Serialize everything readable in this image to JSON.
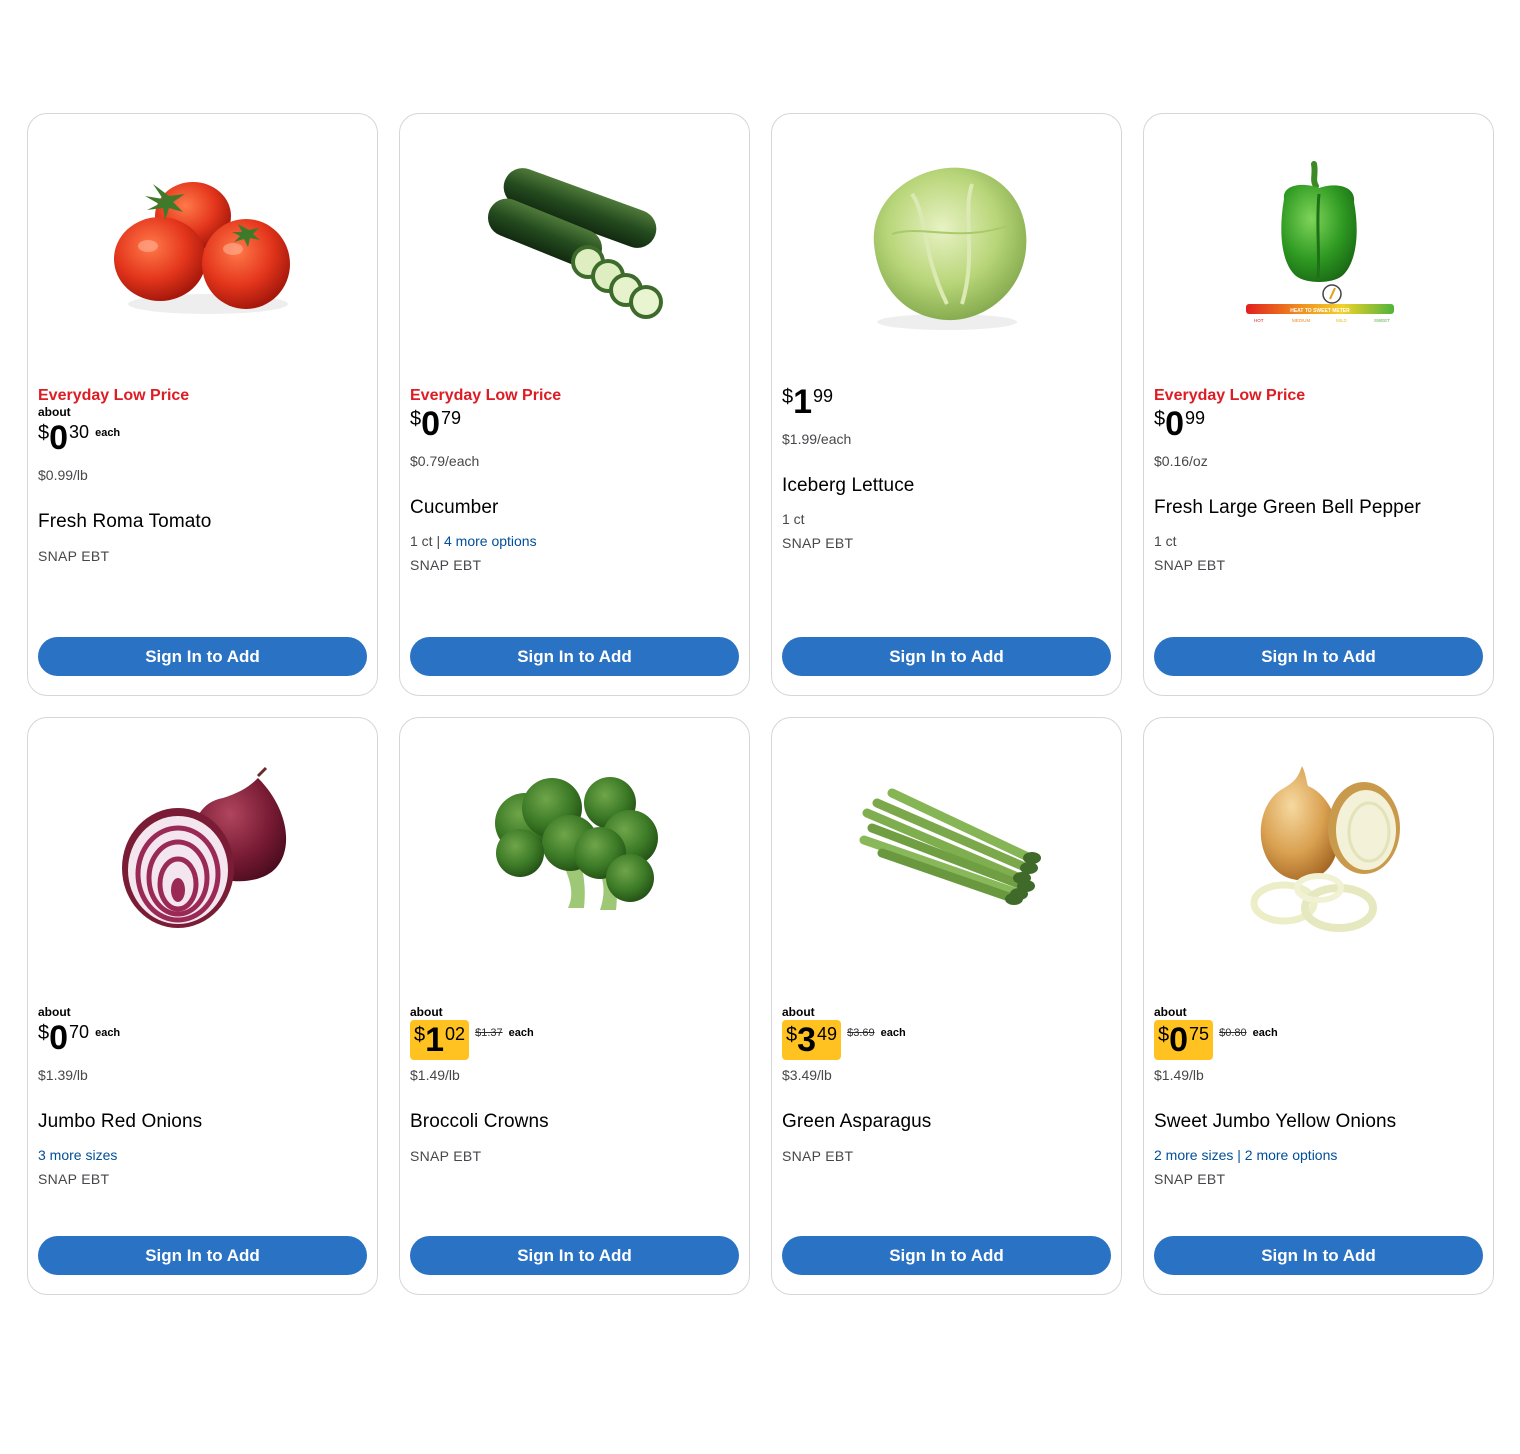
{
  "button_label": "Sign In to Add",
  "products": [
    {
      "flag": "Everyday Low Price",
      "about": "about",
      "price": {
        "currency": "$",
        "dollars": "0",
        "cents": "30",
        "was": "",
        "suffix": "each",
        "rollback": false
      },
      "unit_price": "$0.99/lb",
      "name": "Fresh Roma Tomato",
      "meta_plain": "",
      "meta_link": "",
      "snap": "SNAP EBT",
      "image": "tomato-image"
    },
    {
      "flag": "Everyday Low Price",
      "about": "",
      "price": {
        "currency": "$",
        "dollars": "0",
        "cents": "79",
        "was": "",
        "suffix": "",
        "rollback": false
      },
      "unit_price": "$0.79/each",
      "name": "Cucumber",
      "meta_plain": "1 ct | ",
      "meta_link": "4 more options",
      "snap": "SNAP EBT",
      "image": "cucumber-image"
    },
    {
      "flag": "",
      "about": "",
      "price": {
        "currency": "$",
        "dollars": "1",
        "cents": "99",
        "was": "",
        "suffix": "",
        "rollback": false
      },
      "unit_price": "$1.99/each",
      "name": "Iceberg Lettuce",
      "meta_plain": "1 ct",
      "meta_link": "",
      "snap": "SNAP EBT",
      "image": "lettuce-image"
    },
    {
      "flag": "Everyday Low Price",
      "about": "",
      "price": {
        "currency": "$",
        "dollars": "0",
        "cents": "99",
        "was": "",
        "suffix": "",
        "rollback": false
      },
      "unit_price": "$0.16/oz",
      "name": "Fresh Large Green Bell Pepper",
      "meta_plain": "1 ct",
      "meta_link": "",
      "snap": "SNAP EBT",
      "image": "green-pepper-image",
      "meter": {
        "title": "HEAT TO SWEET METER",
        "labels": [
          "HOT",
          "MEDIUM",
          "MILD",
          "SWEET"
        ]
      }
    },
    {
      "flag": "",
      "about": "about",
      "price": {
        "currency": "$",
        "dollars": "0",
        "cents": "70",
        "was": "",
        "suffix": "each",
        "rollback": false
      },
      "unit_price": "$1.39/lb",
      "name": "Jumbo Red Onions",
      "meta_plain": "",
      "meta_link": "3 more sizes",
      "snap": "SNAP EBT",
      "image": "red-onion-image"
    },
    {
      "flag": "",
      "about": "about",
      "price": {
        "currency": "$",
        "dollars": "1",
        "cents": "02",
        "was": "$1.37",
        "suffix": "each",
        "rollback": true
      },
      "unit_price": "$1.49/lb",
      "name": "Broccoli Crowns",
      "meta_plain": "",
      "meta_link": "",
      "snap": "SNAP EBT",
      "image": "broccoli-image"
    },
    {
      "flag": "",
      "about": "about",
      "price": {
        "currency": "$",
        "dollars": "3",
        "cents": "49",
        "was": "$3.69",
        "suffix": "each",
        "rollback": true
      },
      "unit_price": "$3.49/lb",
      "name": "Green Asparagus",
      "meta_plain": "",
      "meta_link": "",
      "snap": "SNAP EBT",
      "image": "asparagus-image"
    },
    {
      "flag": "",
      "about": "about",
      "price": {
        "currency": "$",
        "dollars": "0",
        "cents": "75",
        "was": "$0.80",
        "suffix": "each",
        "rollback": true
      },
      "unit_price": "$1.49/lb",
      "name": "Sweet Jumbo Yellow Onions",
      "meta_plain": "",
      "meta_link": "2 more sizes | 2 more options",
      "snap": "SNAP EBT",
      "image": "yellow-onion-image"
    }
  ],
  "colors": {
    "flag": "#de1c24",
    "button": "#2a72c4",
    "rollback": "#ffc220",
    "link": "#004f9a"
  }
}
